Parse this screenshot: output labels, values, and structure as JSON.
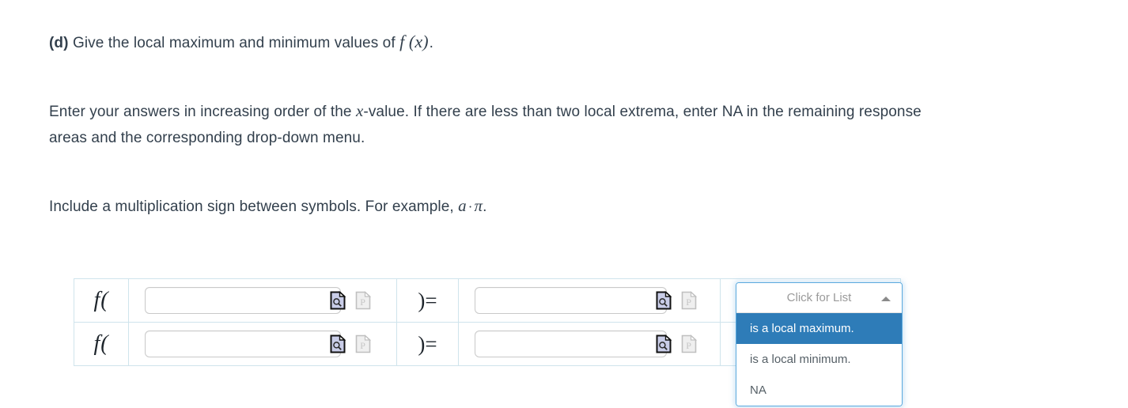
{
  "question": {
    "label": "(d)",
    "prompt_before": "Give the local maximum and minimum values of",
    "prompt_math": "f (x)",
    "prompt_after": "."
  },
  "instructions": {
    "order_part1": "Enter your answers in increasing order of the",
    "order_math": "x",
    "order_part2": "-value. If there are less than two local extrema, enter NA in the remaining response areas and the corresponding drop-down menu.",
    "multiplication_part1": "Include a multiplication sign between symbols. For example,",
    "multiplication_math_a": "a",
    "multiplication_math_dot": "·",
    "multiplication_math_pi": "π",
    "multiplication_part2": "."
  },
  "answer_table": {
    "rows": [
      {
        "f_open": "f(",
        "input_x": {
          "value": "",
          "placeholder": ""
        },
        "close_equals": ")=",
        "input_y": {
          "value": "",
          "placeholder": ""
        }
      },
      {
        "f_open": "f(",
        "input_x": {
          "value": "",
          "placeholder": ""
        },
        "close_equals": ")=",
        "input_y": {
          "value": "",
          "placeholder": ""
        }
      }
    ],
    "icons": {
      "preview": "document-magnifier-icon",
      "palette": "document-p-icon"
    }
  },
  "dropdown": {
    "header_label": "Click for List",
    "caret": "chevron-up-icon",
    "expanded": true,
    "options": [
      {
        "label": "is a local maximum.",
        "selected": true
      },
      {
        "label": "is a local minimum.",
        "selected": false
      },
      {
        "label": "NA",
        "selected": false
      }
    ]
  },
  "colors": {
    "text": "#33404d",
    "table_border": "#cfe4ec",
    "dropdown_border": "#5aa9de",
    "dropdown_highlight": "#2e7cb8",
    "dropdown_header_text": "#9a9a9a"
  }
}
